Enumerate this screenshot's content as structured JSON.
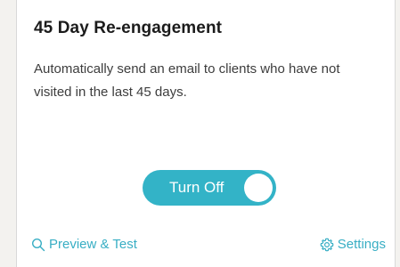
{
  "card": {
    "title": "45 Day Re-engagement",
    "description": "Automatically send an email to clients who have not visited in the last 45 days."
  },
  "toggle": {
    "label": "Turn Off",
    "state": "on",
    "color": "#33b3c7"
  },
  "footer": {
    "preview_label": "Preview & Test",
    "preview_icon": "search-icon",
    "settings_label": "Settings",
    "settings_icon": "gear-icon",
    "link_color": "#38aec4"
  }
}
